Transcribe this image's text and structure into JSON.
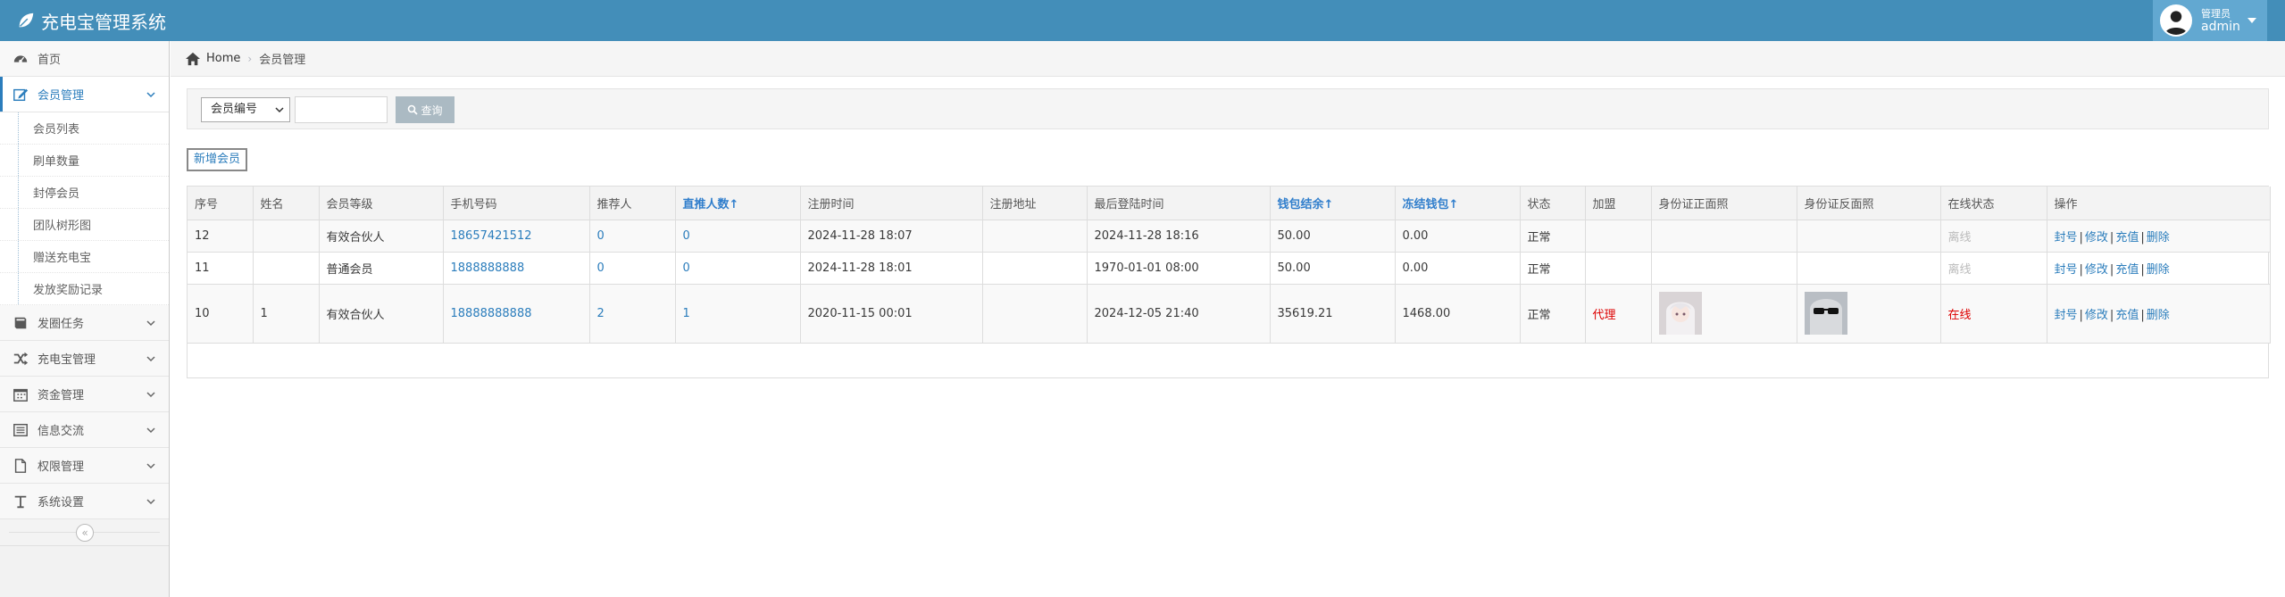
{
  "app": {
    "title": "充电宝管理系统"
  },
  "user": {
    "role": "管理员",
    "name": "admin"
  },
  "sidebar": {
    "items": [
      {
        "label": "首页",
        "icon": "dashboard-icon"
      },
      {
        "label": "会员管理",
        "icon": "edit-icon",
        "active": true,
        "children": [
          "会员列表",
          "刷单数量",
          "封停会员",
          "团队树形图",
          "赠送充电宝",
          "发放奖励记录"
        ]
      },
      {
        "label": "发圈任务",
        "icon": "book-icon"
      },
      {
        "label": "充电宝管理",
        "icon": "shuffle-icon"
      },
      {
        "label": "资金管理",
        "icon": "calendar-icon"
      },
      {
        "label": "信息交流",
        "icon": "list-icon"
      },
      {
        "label": "权限管理",
        "icon": "file-icon"
      },
      {
        "label": "系统设置",
        "icon": "text-icon"
      }
    ],
    "collapse_glyph": "«"
  },
  "breadcrumb": {
    "home": "Home",
    "current": "会员管理"
  },
  "search": {
    "field_selected": "会员编号",
    "value": "",
    "button": "查询"
  },
  "add_button": "新增会员",
  "table": {
    "columns": [
      "序号",
      "姓名",
      "会员等级",
      "手机号码",
      "推荐人",
      "直推人数↑",
      "注册时间",
      "注册地址",
      "最后登陆时间",
      "钱包结余↑",
      "冻结钱包↑",
      "状态",
      "加盟",
      "身份证正面照",
      "身份证反面照",
      "在线状态",
      "操作"
    ],
    "rows": [
      {
        "id": "12",
        "name": "",
        "level": "有效合伙人",
        "phone": "18657421512",
        "referrer": "0",
        "direct": "0",
        "reg_time": "2024-11-28 18:07",
        "reg_addr": "",
        "last_login": "2024-11-28 18:16",
        "wallet": "50.00",
        "frozen": "0.00",
        "status": "正常",
        "franchise": "",
        "online": "离线"
      },
      {
        "id": "11",
        "name": "",
        "level": "普通会员",
        "phone": "1888888888",
        "referrer": "0",
        "direct": "0",
        "reg_time": "2024-11-28 18:01",
        "reg_addr": "",
        "last_login": "1970-01-01 08:00",
        "wallet": "50.00",
        "frozen": "0.00",
        "status": "正常",
        "franchise": "",
        "online": "离线"
      },
      {
        "id": "10",
        "name": "1",
        "level": "有效合伙人",
        "phone": "18888888888",
        "referrer": "2",
        "direct": "1",
        "reg_time": "2020-11-15 00:01",
        "reg_addr": "",
        "last_login": "2024-12-05 21:40",
        "wallet": "35619.21",
        "frozen": "1468.00",
        "status": "正常",
        "franchise": "代理",
        "online": "在线"
      }
    ],
    "ops": {
      "ban": "封号",
      "edit": "修改",
      "recharge": "充值",
      "delete": "删除",
      "sep": "|"
    }
  },
  "colors": {
    "navbar": "#438eb9",
    "link": "#2b7dbc",
    "online": "#dd0000",
    "offline": "#bbbbbb"
  }
}
